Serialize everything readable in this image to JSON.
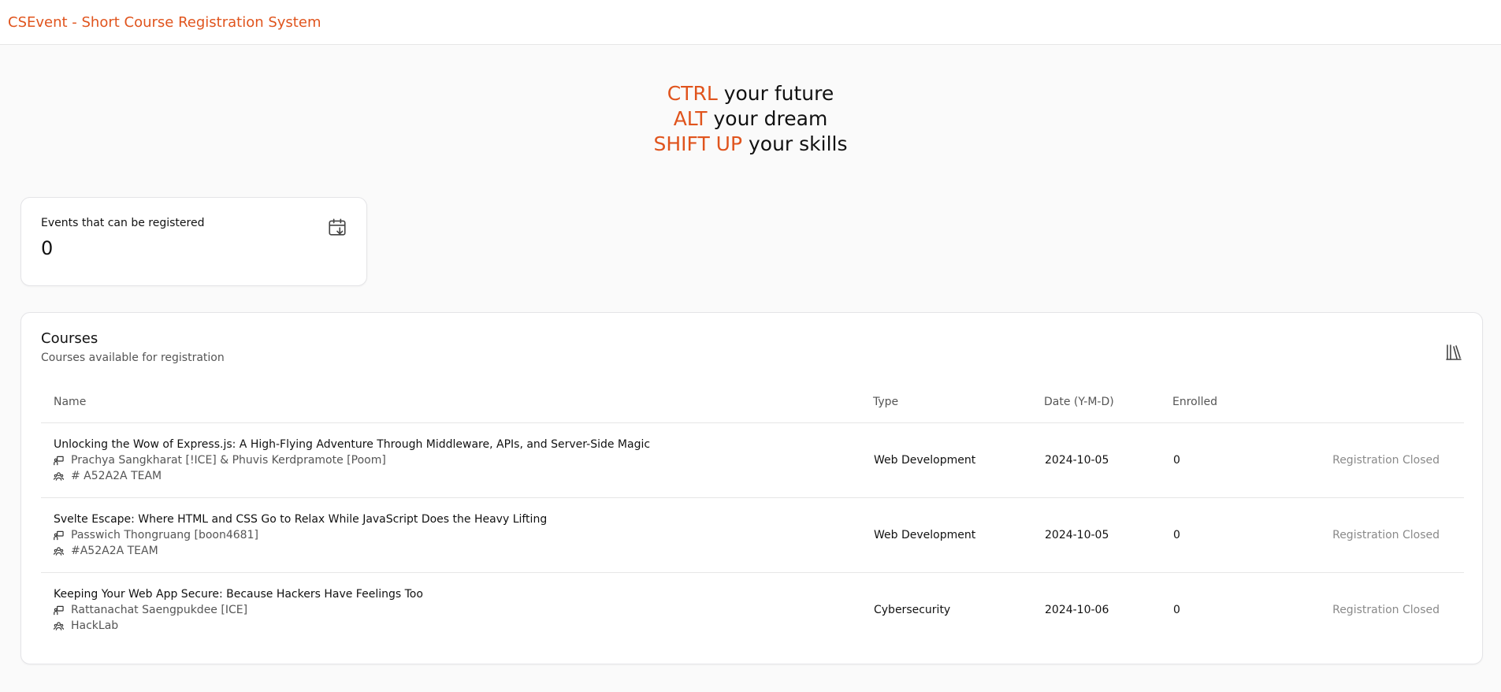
{
  "app": {
    "brand": "CSEvent - Short Course Registration System"
  },
  "hero": {
    "lines": [
      {
        "accent": "CTRL",
        "rest": " your future"
      },
      {
        "accent": "ALT",
        "rest": " your dream"
      },
      {
        "accent": "SHIFT UP",
        "rest": " your skills"
      }
    ]
  },
  "stats": {
    "label": "Events that can be registered",
    "value": "0",
    "icon": "calendar-download-icon"
  },
  "courses": {
    "title": "Courses",
    "subtitle": "Courses available for registration",
    "icon": "library-icon",
    "columns": {
      "name": "Name",
      "type": "Type",
      "date": "Date (Y-M-D)",
      "enrolled": "Enrolled"
    },
    "rows": [
      {
        "title": "Unlocking the Wow of Express.js: A High-Flying Adventure Through Middleware, APIs, and Server-Side Magic",
        "speakers": "Prachya Sangkharat [!ICE] & Phuvis Kerdpramote [Poom]",
        "organizer": "# A52A2A TEAM",
        "type": "Web Development",
        "date": "2024-10-05",
        "enrolled": "0",
        "status": "Registration Closed"
      },
      {
        "title": "Svelte Escape: Where HTML and CSS Go to Relax While JavaScript Does the Heavy Lifting",
        "speakers": "Passwich Thongruang [boon4681]",
        "organizer": "#A52A2A TEAM",
        "type": "Web Development",
        "date": "2024-10-05",
        "enrolled": "0",
        "status": "Registration Closed"
      },
      {
        "title": "Keeping Your Web App Secure: Because Hackers Have Feelings Too",
        "speakers": "Rattanachat Saengpukdee [ICE]",
        "organizer": "HackLab",
        "type": "Cybersecurity",
        "date": "2024-10-06",
        "enrolled": "0",
        "status": "Registration Closed"
      }
    ]
  },
  "colors": {
    "accent": "#e0541d",
    "muted": "#8a8a8a"
  }
}
